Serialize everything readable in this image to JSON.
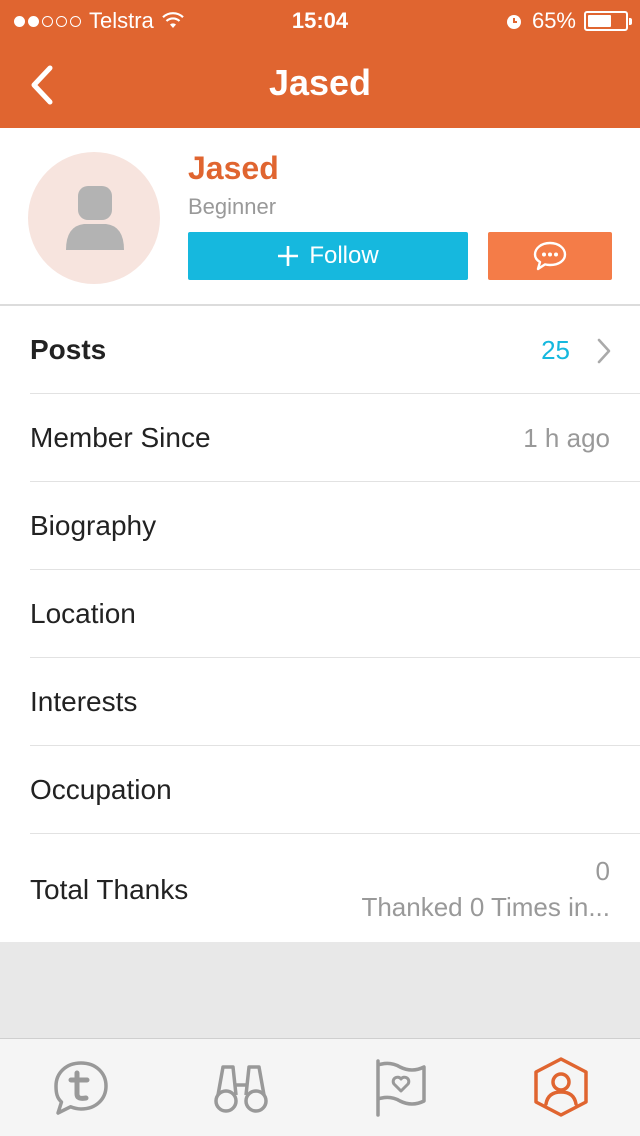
{
  "status_bar": {
    "carrier": "Telstra",
    "time": "15:04",
    "battery_percent": "65%",
    "battery_level": 0.65,
    "signal_dots_filled": 2,
    "signal_dots_total": 5
  },
  "nav": {
    "title": "Jased",
    "back_icon": "chevron-left-icon"
  },
  "profile": {
    "name": "Jased",
    "rank": "Beginner",
    "follow_label": "Follow",
    "avatar_icon": "user-placeholder-icon",
    "message_icon": "chat-bubble-icon"
  },
  "rows": {
    "posts": {
      "label": "Posts",
      "value": "25"
    },
    "member_since": {
      "label": "Member Since",
      "value": "1 h ago"
    },
    "biography": {
      "label": "Biography"
    },
    "location": {
      "label": "Location"
    },
    "interests": {
      "label": "Interests"
    },
    "occupation": {
      "label": "Occupation"
    },
    "total_thanks": {
      "label": "Total Thanks",
      "value": "0",
      "subvalue": "Thanked 0 Times in..."
    }
  },
  "tabs": [
    {
      "name": "tapatalk-icon",
      "active": false
    },
    {
      "name": "binoculars-icon",
      "active": false
    },
    {
      "name": "flag-heart-icon",
      "active": false
    },
    {
      "name": "profile-icon",
      "active": true
    }
  ],
  "colors": {
    "brand_orange": "#e06530",
    "follow_blue": "#16b8de",
    "message_orange": "#f47c48"
  }
}
